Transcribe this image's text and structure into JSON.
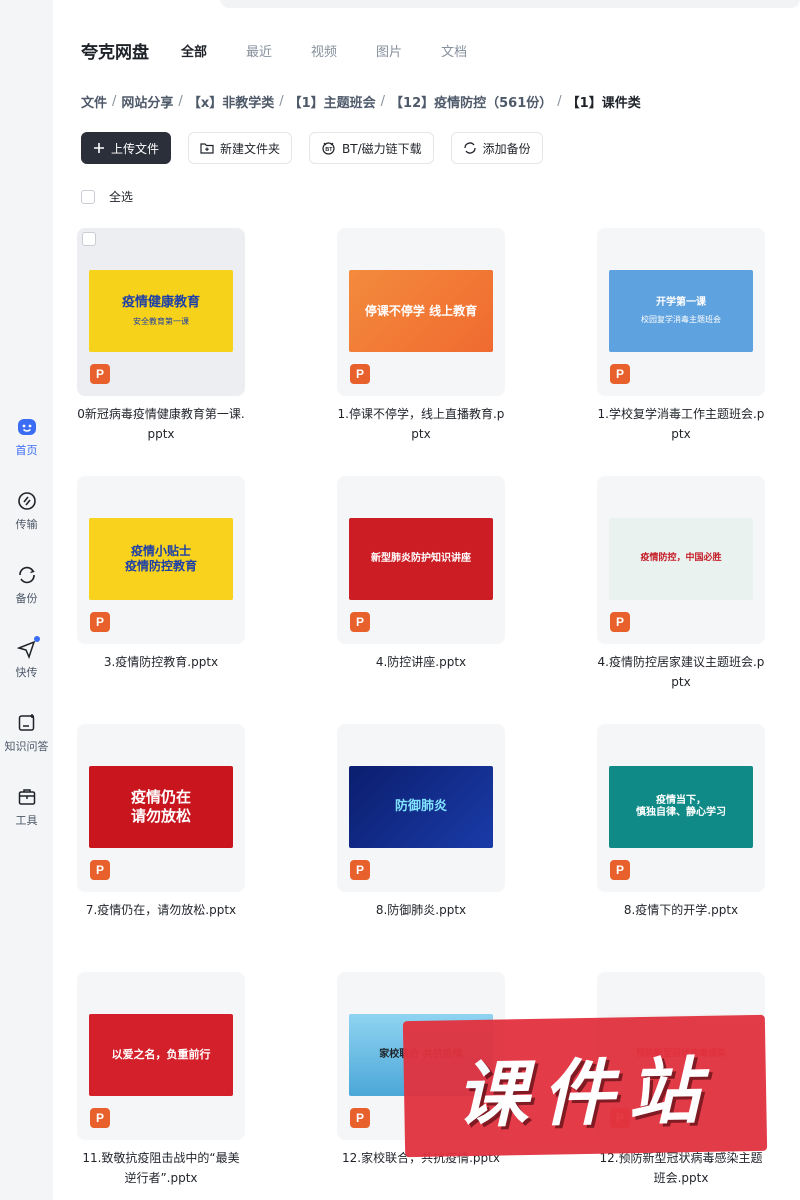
{
  "sidebar": {
    "items": [
      {
        "label": "首页",
        "icon": "home-icon",
        "active": true
      },
      {
        "label": "传输",
        "icon": "transfer-icon"
      },
      {
        "label": "备份",
        "icon": "backup-icon"
      },
      {
        "label": "快传",
        "icon": "quick-send-icon"
      },
      {
        "label": "知识问答",
        "icon": "knowledge-qa-icon"
      },
      {
        "label": "工具",
        "icon": "tools-icon"
      }
    ]
  },
  "header": {
    "brand": "夸克网盘",
    "tabs": [
      {
        "label": "全部",
        "active": true
      },
      {
        "label": "最近"
      },
      {
        "label": "视频"
      },
      {
        "label": "图片"
      },
      {
        "label": "文档"
      }
    ]
  },
  "breadcrumb": [
    "文件",
    "网站分享",
    "【x】非教学类",
    "【1】主题班会",
    "【12】疫情防控（561份）",
    "【1】课件类"
  ],
  "toolbar": {
    "upload": "上传文件",
    "new_folder": "新建文件夹",
    "bt_download": "BT/磁力链下载",
    "add_backup": "添加备份"
  },
  "select_all": "全选",
  "files": [
    {
      "name": "0新冠病毒疫情健康教育第一课.pptx",
      "thumb_title": "疫情健康教育",
      "thumb_sub": "安全教育第一课"
    },
    {
      "name": "1.停课不停学，线上直播教育.pptx",
      "thumb_title": "停课不停学 线上教育",
      "thumb_sub": ""
    },
    {
      "name": "1.学校复学消毒工作主题班会.pptx",
      "thumb_title": "开学第一课",
      "thumb_sub": "校园复学消毒主题班会"
    },
    {
      "name": "3.疫情防控教育.pptx",
      "thumb_title": "疫情小贴士\n疫情防控教育",
      "thumb_sub": ""
    },
    {
      "name": "4.防控讲座.pptx",
      "thumb_title": "新型肺炎防护知识讲座",
      "thumb_sub": ""
    },
    {
      "name": "4.疫情防控居家建议主题班会.pptx",
      "thumb_title": "疫情防控，中国必胜",
      "thumb_sub": ""
    },
    {
      "name": "7.疫情仍在，请勿放松.pptx",
      "thumb_title": "疫情仍在\n请勿放松",
      "thumb_sub": ""
    },
    {
      "name": "8.防御肺炎.pptx",
      "thumb_title": "防御肺炎",
      "thumb_sub": ""
    },
    {
      "name": "8.疫情下的开学.pptx",
      "thumb_title": "疫情当下，\n慎独自律、静心学习",
      "thumb_sub": ""
    },
    {
      "name": "11.致敬抗疫阻击战中的“最美逆行者”.pptx",
      "thumb_title": "以爱之名，负重前行",
      "thumb_sub": ""
    },
    {
      "name": "12.家校联合，共抗疫情.pptx",
      "thumb_title": "家校联合 共抗疫情",
      "thumb_sub": ""
    },
    {
      "name": "12.预防新型冠状病毒感染主题班会.pptx",
      "thumb_title": "预防新型冠状病毒感染",
      "thumb_sub": ""
    }
  ],
  "file_type_badge": "P",
  "watermark": "课件站",
  "colors": {
    "accent": "#3a6cf4",
    "ppt": "#e8612c",
    "primary_button": "#2b2f3a",
    "watermark": "#e2323f"
  }
}
